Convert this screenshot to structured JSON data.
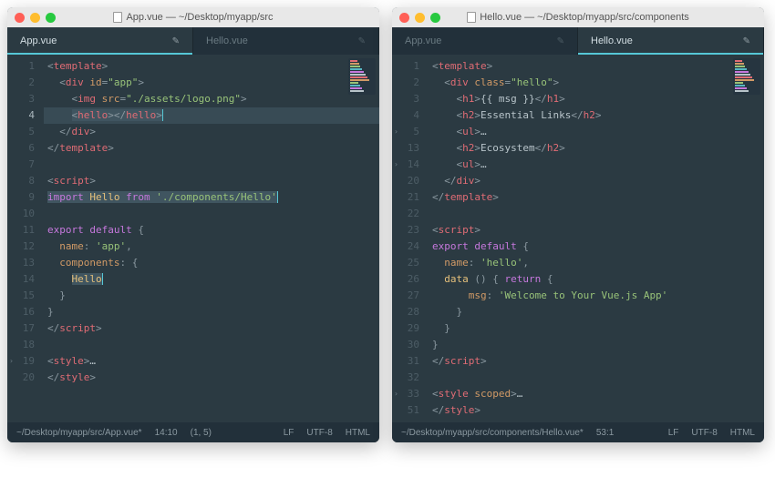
{
  "windows": [
    {
      "title": "App.vue — ~/Desktop/myapp/src",
      "tabs": [
        {
          "label": "App.vue",
          "active": true,
          "modified": true
        },
        {
          "label": "Hello.vue",
          "active": false,
          "modified": true
        }
      ],
      "status": {
        "path": "~/Desktop/myapp/src/App.vue*",
        "time": "14:10",
        "pos": "(1, 5)",
        "eol": "LF",
        "enc": "UTF-8",
        "lang": "HTML"
      },
      "current_line": 4,
      "gutter": [
        {
          "n": "1"
        },
        {
          "n": "2"
        },
        {
          "n": "3"
        },
        {
          "n": "4"
        },
        {
          "n": "5"
        },
        {
          "n": "6"
        },
        {
          "n": "7"
        },
        {
          "n": "8"
        },
        {
          "n": "9"
        },
        {
          "n": "10"
        },
        {
          "n": "11"
        },
        {
          "n": "12"
        },
        {
          "n": "13"
        },
        {
          "n": "14"
        },
        {
          "n": "15"
        },
        {
          "n": "16"
        },
        {
          "n": "17"
        },
        {
          "n": "18"
        },
        {
          "n": "19",
          "fold": true
        },
        {
          "n": "20"
        }
      ],
      "code_lines": [
        {
          "tokens": [
            [
              "punc",
              "<"
            ],
            [
              "tag",
              "template"
            ],
            [
              "punc",
              ">"
            ]
          ]
        },
        {
          "tokens": [
            [
              "txt",
              "  "
            ],
            [
              "punc",
              "<"
            ],
            [
              "tag",
              "div"
            ],
            [
              "txt",
              " "
            ],
            [
              "attr",
              "id"
            ],
            [
              "punc",
              "="
            ],
            [
              "str",
              "\"app\""
            ],
            [
              "punc",
              ">"
            ]
          ]
        },
        {
          "tokens": [
            [
              "txt",
              "    "
            ],
            [
              "punc",
              "<"
            ],
            [
              "tag",
              "img"
            ],
            [
              "txt",
              " "
            ],
            [
              "attr",
              "src"
            ],
            [
              "punc",
              "="
            ],
            [
              "str",
              "\"./assets/logo.png\""
            ],
            [
              "punc",
              ">"
            ]
          ]
        },
        {
          "sel": true,
          "tokens": [
            [
              "txt",
              "    "
            ],
            [
              "sel-open",
              ""
            ],
            [
              "punc",
              "<"
            ],
            [
              "tag",
              "hello"
            ],
            [
              "punc",
              "></"
            ],
            [
              "tag",
              "hello"
            ],
            [
              "punc",
              ">"
            ],
            [
              "sel-close",
              ""
            ],
            [
              "cursor",
              ""
            ]
          ]
        },
        {
          "tokens": [
            [
              "txt",
              "  "
            ],
            [
              "punc",
              "</"
            ],
            [
              "tag",
              "div"
            ],
            [
              "punc",
              ">"
            ]
          ]
        },
        {
          "tokens": [
            [
              "punc",
              "</"
            ],
            [
              "tag",
              "template"
            ],
            [
              "punc",
              ">"
            ]
          ]
        },
        {
          "tokens": [
            [
              "txt",
              ""
            ]
          ]
        },
        {
          "tokens": [
            [
              "punc",
              "<"
            ],
            [
              "tag",
              "script"
            ],
            [
              "punc",
              ">"
            ]
          ]
        },
        {
          "tokens": [
            [
              "sel-open",
              ""
            ],
            [
              "kw",
              "import"
            ],
            [
              "txt",
              " "
            ],
            [
              "ident",
              "Hello"
            ],
            [
              "txt",
              " "
            ],
            [
              "kw",
              "from"
            ],
            [
              "txt",
              " "
            ],
            [
              "str",
              "'./components/Hello'"
            ],
            [
              "sel-close",
              ""
            ],
            [
              "cursor",
              ""
            ]
          ]
        },
        {
          "tokens": [
            [
              "txt",
              ""
            ]
          ]
        },
        {
          "tokens": [
            [
              "kw",
              "export"
            ],
            [
              "txt",
              " "
            ],
            [
              "kw",
              "default"
            ],
            [
              "txt",
              " "
            ],
            [
              "punc",
              "{"
            ]
          ]
        },
        {
          "tokens": [
            [
              "txt",
              "  "
            ],
            [
              "attr",
              "name"
            ],
            [
              "punc",
              ":"
            ],
            [
              "txt",
              " "
            ],
            [
              "str",
              "'app'"
            ],
            [
              "punc",
              ","
            ]
          ]
        },
        {
          "tokens": [
            [
              "txt",
              "  "
            ],
            [
              "attr",
              "components"
            ],
            [
              "punc",
              ":"
            ],
            [
              "txt",
              " "
            ],
            [
              "punc",
              "{"
            ]
          ]
        },
        {
          "tokens": [
            [
              "txt",
              "    "
            ],
            [
              "sel-open",
              ""
            ],
            [
              "ident",
              "Hello"
            ],
            [
              "sel-close",
              ""
            ],
            [
              "cursor",
              ""
            ]
          ]
        },
        {
          "tokens": [
            [
              "txt",
              "  "
            ],
            [
              "punc",
              "}"
            ]
          ]
        },
        {
          "tokens": [
            [
              "punc",
              "}"
            ]
          ]
        },
        {
          "tokens": [
            [
              "punc",
              "</"
            ],
            [
              "tag",
              "script"
            ],
            [
              "punc",
              ">"
            ]
          ]
        },
        {
          "tokens": [
            [
              "txt",
              ""
            ]
          ]
        },
        {
          "tokens": [
            [
              "punc",
              "<"
            ],
            [
              "tag",
              "style"
            ],
            [
              "punc",
              ">"
            ],
            [
              "txt",
              "…"
            ]
          ]
        },
        {
          "tokens": [
            [
              "punc",
              "</"
            ],
            [
              "tag",
              "style"
            ],
            [
              "punc",
              ">"
            ]
          ]
        }
      ]
    },
    {
      "title": "Hello.vue — ~/Desktop/myapp/src/components",
      "tabs": [
        {
          "label": "App.vue",
          "active": false,
          "modified": true
        },
        {
          "label": "Hello.vue",
          "active": true,
          "modified": true
        }
      ],
      "status": {
        "path": "~/Desktop/myapp/src/components/Hello.vue*",
        "time": "53:1",
        "pos": "",
        "eol": "LF",
        "enc": "UTF-8",
        "lang": "HTML"
      },
      "current_line": 0,
      "gutter": [
        {
          "n": "1"
        },
        {
          "n": "2"
        },
        {
          "n": "3"
        },
        {
          "n": "4"
        },
        {
          "n": "5",
          "fold": true
        },
        {
          "n": "13"
        },
        {
          "n": "14",
          "fold": true
        },
        {
          "n": "20"
        },
        {
          "n": "21"
        },
        {
          "n": "22"
        },
        {
          "n": "23"
        },
        {
          "n": "24"
        },
        {
          "n": "25"
        },
        {
          "n": "26"
        },
        {
          "n": "27"
        },
        {
          "n": "28"
        },
        {
          "n": "29"
        },
        {
          "n": "30"
        },
        {
          "n": "31"
        },
        {
          "n": "32"
        },
        {
          "n": "33",
          "fold": true
        },
        {
          "n": "51"
        }
      ],
      "code_lines": [
        {
          "tokens": [
            [
              "punc",
              "<"
            ],
            [
              "tag",
              "template"
            ],
            [
              "punc",
              ">"
            ]
          ]
        },
        {
          "tokens": [
            [
              "txt",
              "  "
            ],
            [
              "punc",
              "<"
            ],
            [
              "tag",
              "div"
            ],
            [
              "txt",
              " "
            ],
            [
              "attr",
              "class"
            ],
            [
              "punc",
              "="
            ],
            [
              "str",
              "\"hello\""
            ],
            [
              "punc",
              ">"
            ]
          ]
        },
        {
          "tokens": [
            [
              "txt",
              "    "
            ],
            [
              "punc",
              "<"
            ],
            [
              "tag",
              "h1"
            ],
            [
              "punc",
              ">"
            ],
            [
              "txt",
              "{{ msg }}"
            ],
            [
              "punc",
              "</"
            ],
            [
              "tag",
              "h1"
            ],
            [
              "punc",
              ">"
            ]
          ]
        },
        {
          "tokens": [
            [
              "txt",
              "    "
            ],
            [
              "punc",
              "<"
            ],
            [
              "tag",
              "h2"
            ],
            [
              "punc",
              ">"
            ],
            [
              "txt",
              "Essential Links"
            ],
            [
              "punc",
              "</"
            ],
            [
              "tag",
              "h2"
            ],
            [
              "punc",
              ">"
            ]
          ]
        },
        {
          "tokens": [
            [
              "txt",
              "    "
            ],
            [
              "punc",
              "<"
            ],
            [
              "tag",
              "ul"
            ],
            [
              "punc",
              ">"
            ],
            [
              "txt",
              "…"
            ]
          ]
        },
        {
          "tokens": [
            [
              "txt",
              "    "
            ],
            [
              "punc",
              "<"
            ],
            [
              "tag",
              "h2"
            ],
            [
              "punc",
              ">"
            ],
            [
              "txt",
              "Ecosystem"
            ],
            [
              "punc",
              "</"
            ],
            [
              "tag",
              "h2"
            ],
            [
              "punc",
              ">"
            ]
          ]
        },
        {
          "tokens": [
            [
              "txt",
              "    "
            ],
            [
              "punc",
              "<"
            ],
            [
              "tag",
              "ul"
            ],
            [
              "punc",
              ">"
            ],
            [
              "txt",
              "…"
            ]
          ]
        },
        {
          "tokens": [
            [
              "txt",
              "  "
            ],
            [
              "punc",
              "</"
            ],
            [
              "tag",
              "div"
            ],
            [
              "punc",
              ">"
            ]
          ]
        },
        {
          "tokens": [
            [
              "punc",
              "</"
            ],
            [
              "tag",
              "template"
            ],
            [
              "punc",
              ">"
            ]
          ]
        },
        {
          "tokens": [
            [
              "txt",
              ""
            ]
          ]
        },
        {
          "tokens": [
            [
              "punc",
              "<"
            ],
            [
              "tag",
              "script"
            ],
            [
              "punc",
              ">"
            ]
          ]
        },
        {
          "tokens": [
            [
              "kw",
              "export"
            ],
            [
              "txt",
              " "
            ],
            [
              "kw",
              "default"
            ],
            [
              "txt",
              " "
            ],
            [
              "punc",
              "{"
            ]
          ]
        },
        {
          "tokens": [
            [
              "txt",
              "  "
            ],
            [
              "attr",
              "name"
            ],
            [
              "punc",
              ":"
            ],
            [
              "txt",
              " "
            ],
            [
              "str",
              "'hello'"
            ],
            [
              "punc",
              ","
            ]
          ]
        },
        {
          "tokens": [
            [
              "txt",
              "  "
            ],
            [
              "ident",
              "data"
            ],
            [
              "txt",
              " "
            ],
            [
              "punc",
              "() { "
            ],
            [
              "kw",
              "return"
            ],
            [
              "txt",
              " "
            ],
            [
              "punc",
              "{"
            ]
          ]
        },
        {
          "tokens": [
            [
              "txt",
              "      "
            ],
            [
              "attr",
              "msg"
            ],
            [
              "punc",
              ":"
            ],
            [
              "txt",
              " "
            ],
            [
              "str",
              "'Welcome to Your Vue.js App'"
            ]
          ]
        },
        {
          "tokens": [
            [
              "txt",
              "    "
            ],
            [
              "punc",
              "}"
            ]
          ]
        },
        {
          "tokens": [
            [
              "txt",
              "  "
            ],
            [
              "punc",
              "}"
            ]
          ]
        },
        {
          "tokens": [
            [
              "punc",
              "}"
            ]
          ]
        },
        {
          "tokens": [
            [
              "punc",
              "</"
            ],
            [
              "tag",
              "script"
            ],
            [
              "punc",
              ">"
            ]
          ]
        },
        {
          "tokens": [
            [
              "txt",
              ""
            ]
          ]
        },
        {
          "tokens": [
            [
              "punc",
              "<"
            ],
            [
              "tag",
              "style"
            ],
            [
              "txt",
              " "
            ],
            [
              "attr",
              "scoped"
            ],
            [
              "punc",
              ">"
            ],
            [
              "txt",
              "…"
            ]
          ]
        },
        {
          "tokens": [
            [
              "punc",
              "</"
            ],
            [
              "tag",
              "style"
            ],
            [
              "punc",
              ">"
            ]
          ]
        }
      ]
    }
  ],
  "minimap_colors": [
    "#e06c75",
    "#d19a66",
    "#98c379",
    "#56b6c2",
    "#c678dd",
    "#b8c4ca"
  ]
}
